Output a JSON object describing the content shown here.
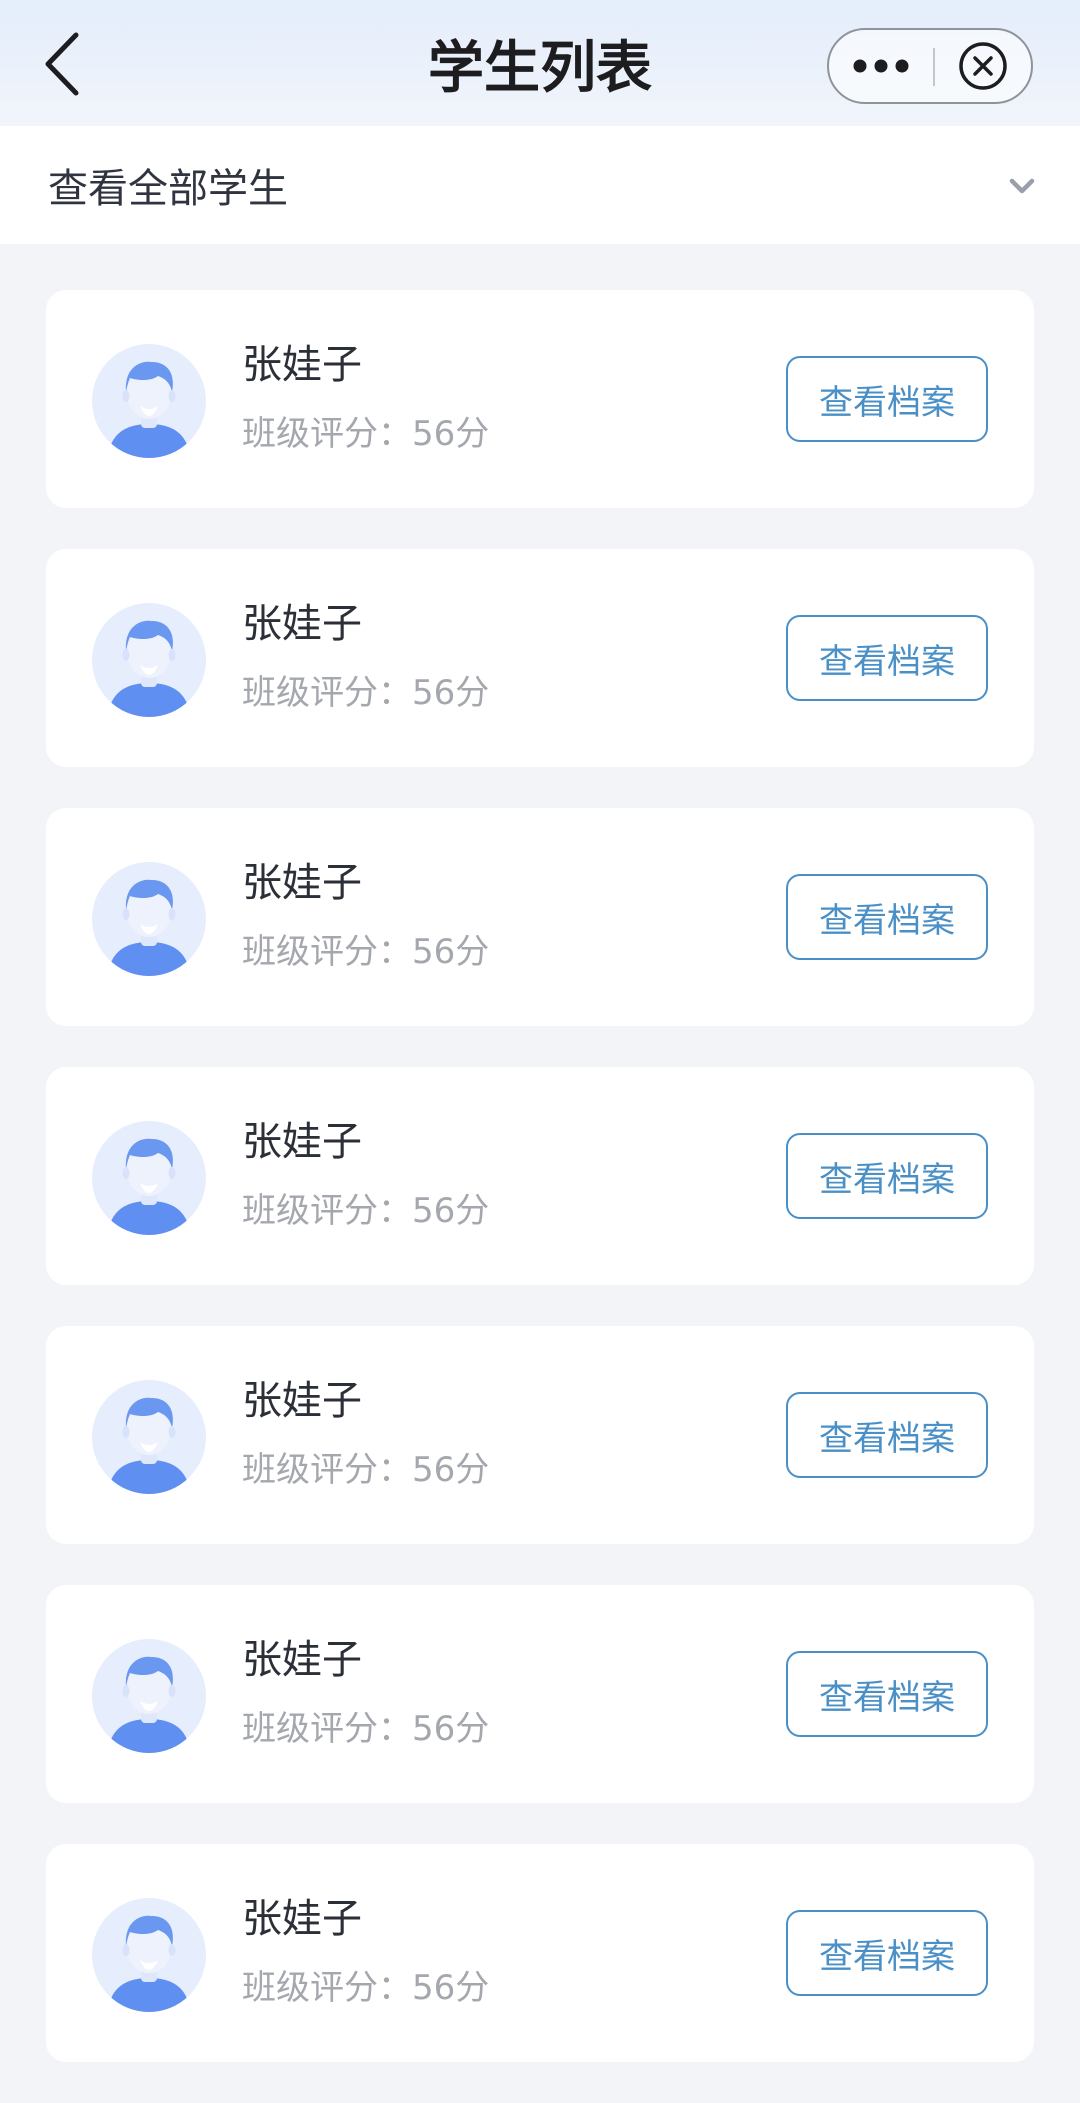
{
  "header": {
    "title": "学生列表",
    "back_icon": "chevron-left-icon",
    "more_icon": "more-dots-icon",
    "close_icon": "circle-close-icon"
  },
  "filter": {
    "label": "查看全部学生",
    "icon": "chevron-down-icon"
  },
  "colors": {
    "accent": "#4a90c6",
    "avatar_blue": "#6a97ef",
    "background": "#f2f4f8"
  },
  "students": [
    {
      "name": "张娃子",
      "score_text": "班级评分：56分",
      "action": "查看档案"
    },
    {
      "name": "张娃子",
      "score_text": "班级评分：56分",
      "action": "查看档案"
    },
    {
      "name": "张娃子",
      "score_text": "班级评分：56分",
      "action": "查看档案"
    },
    {
      "name": "张娃子",
      "score_text": "班级评分：56分",
      "action": "查看档案"
    },
    {
      "name": "张娃子",
      "score_text": "班级评分：56分",
      "action": "查看档案"
    },
    {
      "name": "张娃子",
      "score_text": "班级评分：56分",
      "action": "查看档案"
    },
    {
      "name": "张娃子",
      "score_text": "班级评分：56分",
      "action": "查看档案"
    }
  ]
}
